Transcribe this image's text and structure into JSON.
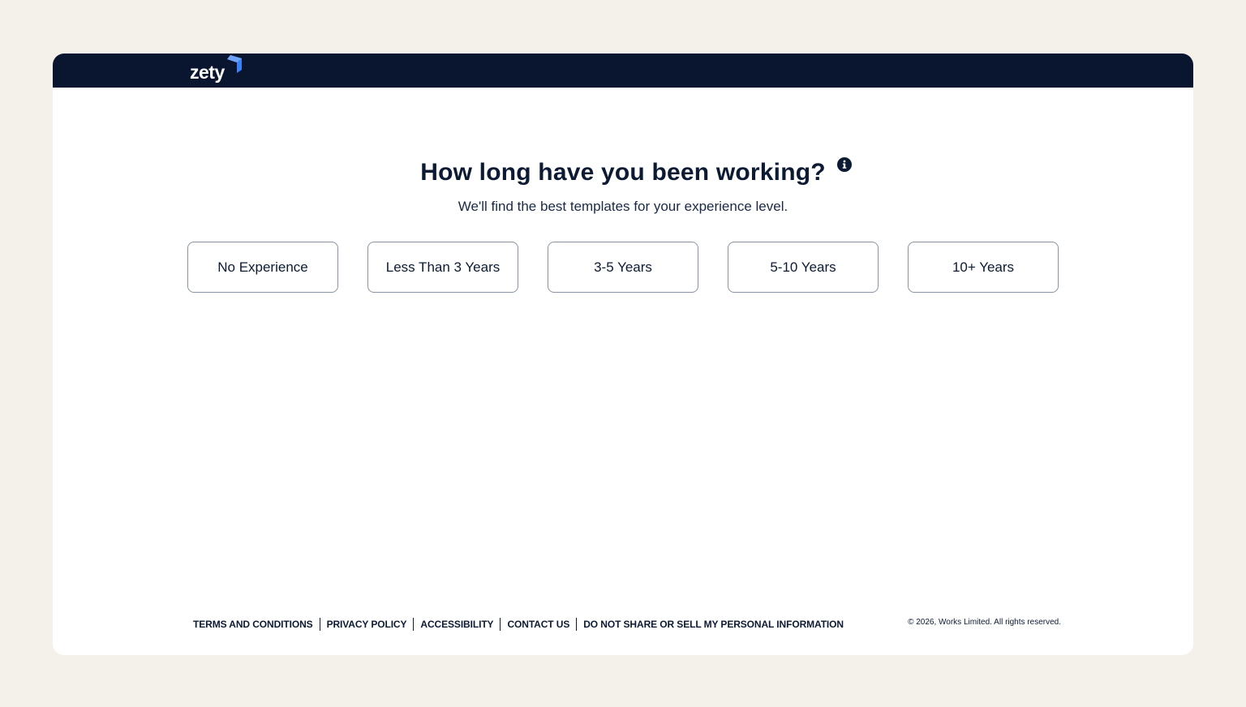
{
  "brand": {
    "logo_text": "zety",
    "logo_icon": "zety-chevron-logo",
    "accent": "#3b82f6",
    "topbar_color": "#0a1630"
  },
  "main": {
    "title": "How long have you been working?",
    "info_icon": "info-icon",
    "subtitle": "We'll find the best templates for your experience level.",
    "options": [
      {
        "label": "No Experience"
      },
      {
        "label": "Less Than 3 Years"
      },
      {
        "label": "3-5 Years"
      },
      {
        "label": "5-10 Years"
      },
      {
        "label": "10+ Years"
      }
    ]
  },
  "footer": {
    "links": [
      {
        "label": "TERMS AND CONDITIONS"
      },
      {
        "label": "PRIVACY POLICY"
      },
      {
        "label": "ACCESSIBILITY"
      },
      {
        "label": "CONTACT US"
      },
      {
        "label": "DO NOT SHARE OR SELL MY PERSONAL INFORMATION"
      }
    ],
    "copyright": "© 2026, Works Limited. All rights reserved."
  }
}
